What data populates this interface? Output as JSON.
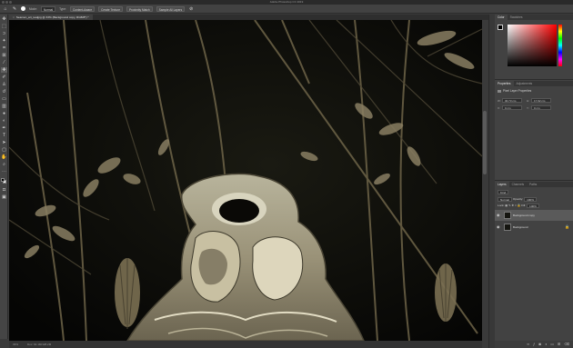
{
  "app": {
    "title": "Adobe Photoshop CC 2019"
  },
  "options_bar": {
    "mode_label": "Mode:",
    "mode_value": "Normal",
    "type_label": "Type:",
    "type_buttons": [
      "Content-Aware",
      "Create Texture",
      "Proximity Match"
    ],
    "sample_all_layers": "Sample All Layers"
  },
  "document": {
    "tab_title": "Seamen_art_teatjpg @ 33% (Background copy, RGB/8*) *"
  },
  "status": {
    "zoom": "33%",
    "doc_info": "Doc: 64.1M/128.2M"
  },
  "panels": {
    "color": {
      "tabs": [
        "Color",
        "Swatches"
      ],
      "fg": "#000000",
      "bg": "#ffffff"
    },
    "properties": {
      "tabs": [
        "Properties",
        "Adjustments"
      ],
      "subtitle": "Pixel Layer Properties",
      "w_label": "W:",
      "w_value": "30.73 cm",
      "h_label": "H:",
      "h_value": "17.92 cm",
      "x_label": "X:",
      "x_value": "0 cm",
      "y_label": "Y:",
      "y_value": "0 cm"
    },
    "layers": {
      "tabs": [
        "Layers",
        "Channels",
        "Paths"
      ],
      "filter": "Kind",
      "blend_mode": "Normal",
      "opacity_label": "Opacity:",
      "opacity": "100%",
      "lock_label": "Lock:",
      "fill_label": "Fill:",
      "fill": "100%",
      "items": [
        {
          "name": "Background copy",
          "selected": true
        },
        {
          "name": "Background",
          "selected": false
        }
      ]
    }
  },
  "colors": {
    "ui_bg": "#3a3a3a",
    "panel": "#424242",
    "canvas": "#0b0b07",
    "accent": "#2d8ceb"
  }
}
